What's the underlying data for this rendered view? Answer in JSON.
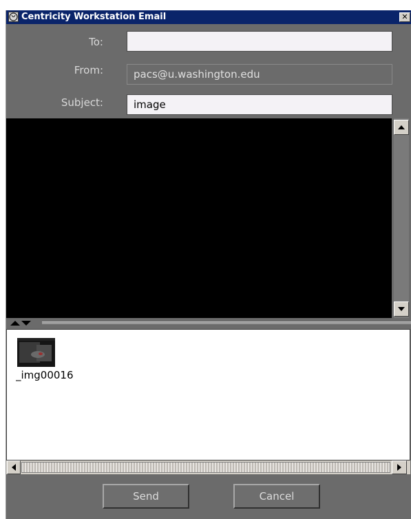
{
  "window": {
    "title": "Centricity Workstation Email"
  },
  "form": {
    "to_label": "To:",
    "to_value": "",
    "from_label": "From:",
    "from_value": "pacs@u.washington.edu",
    "subject_label": "Subject:",
    "subject_value": "image"
  },
  "attachments": [
    {
      "filename": "_img00016"
    }
  ],
  "buttons": {
    "send": "Send",
    "cancel": "Cancel"
  },
  "icons": {
    "app": "ge-logo-icon",
    "close": "close-icon",
    "scroll_up": "arrow-up-icon",
    "scroll_down": "arrow-down-icon",
    "scroll_left": "arrow-left-icon",
    "scroll_right": "arrow-right-icon",
    "splitter": "splitter-arrows-icon"
  },
  "colors": {
    "titlebar": "#0a246a",
    "panel": "#6b6b6b",
    "body": "#000000"
  }
}
